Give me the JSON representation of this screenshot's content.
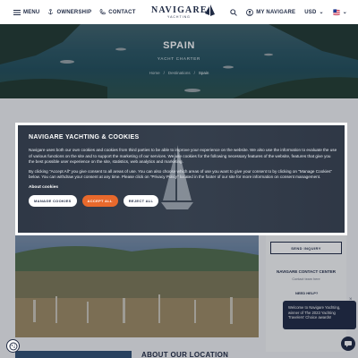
{
  "header": {
    "menu_label": "MENU",
    "ownership_label": "OWNERSHIP",
    "contact_label": "CONTACT",
    "logo_text": "NAVIGARE",
    "logo_sub": "YACHTING",
    "account_label": "MY NAVIGARE",
    "currency": "USD",
    "currency_arrow": "⌄",
    "language_arrow": "⌄"
  },
  "hero": {
    "title": "SPAIN",
    "subtitle": "YACHT CHARTER",
    "breadcrumbs": [
      "Home",
      "/",
      "Destinations",
      "/",
      "Spain"
    ]
  },
  "sidebar": {
    "send_inquiry": "SEND INQUIRY",
    "contact_title": "NAVIGARE CONTACT CENTER",
    "contact_sub": "Contact team here"
  },
  "chat": {
    "need_help": "NEED HELP?",
    "message": "Welcome to Navigare Yachting, winner of The 2023 Yachting Travelers' Choice awards!",
    "close": "×"
  },
  "about": {
    "title": "ABOUT OUR LOCATION"
  },
  "cookie_modal": {
    "title": "NAVIGARE YACHTING & COOKIES",
    "paragraph1": "Navigare uses both our own cookies and cookies from third parties to be able to improve your experience on the website. We also use the information to evaluate the use of various functions on the site and to support the marketing of our services. We use cookies for the following necessary features of the website, features that give you the best possible user experience on the site, statistics, web analytics and marketing.",
    "paragraph2": "By clicking \"Accept All\" you give consent to all areas of use. You can also choose which areas of use you want to give your consent to by clicking on \"Manage Cookies\" below. You can withdraw your consent at any time. Please click on \"Privacy Policy\" located in the footer of our site for more information on consent management.",
    "about_cookies": "About cookies",
    "manage_label": "MANAGE COOKIES",
    "accept_label": "ACCEPT ALL",
    "reject_label": "REJECT ALL"
  },
  "colors": {
    "brand_navy": "#1f2a44",
    "accept_orange": "#e8692c"
  },
  "icons": [
    "hamburger-icon",
    "anchor-icon",
    "phone-icon",
    "logo-mark-icon",
    "search-icon",
    "account-icon",
    "flag-icon",
    "cookie-icon",
    "chat-icon"
  ]
}
